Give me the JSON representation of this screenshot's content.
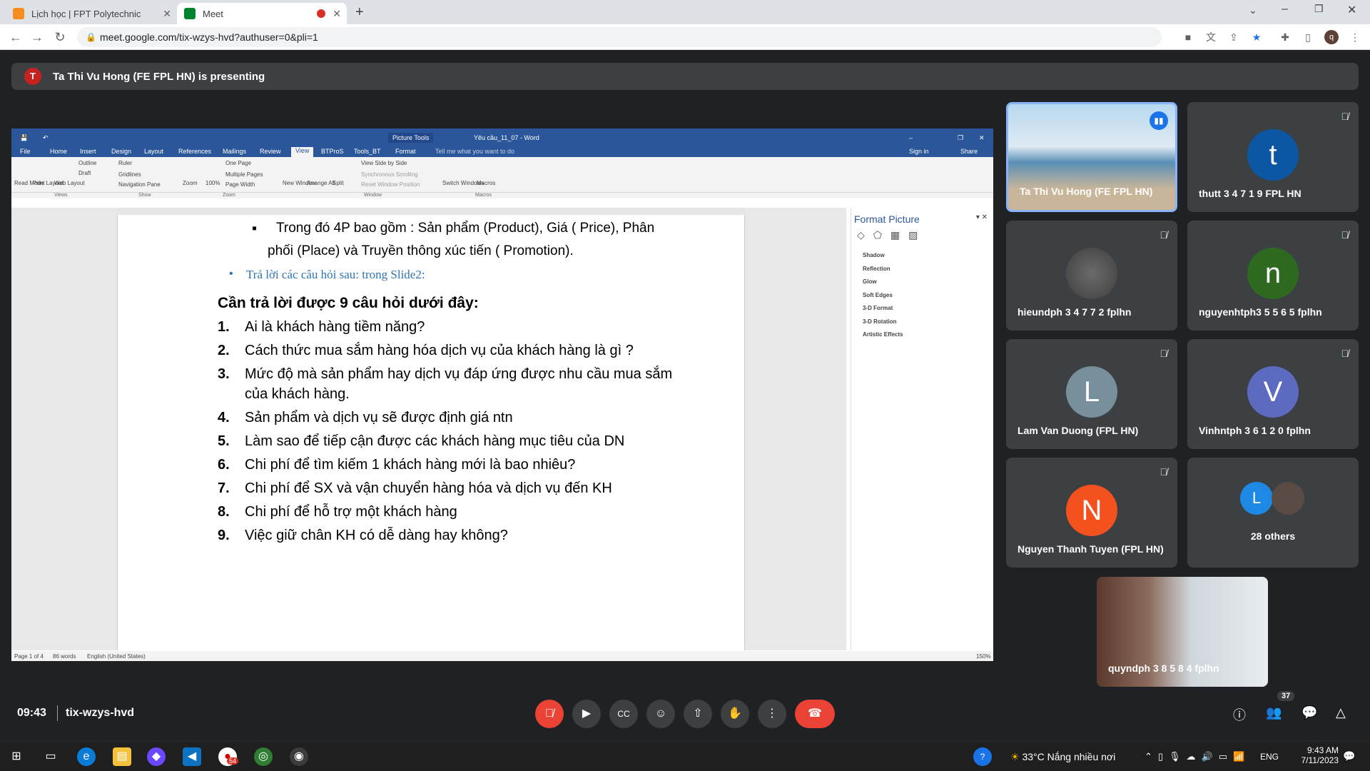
{
  "browser": {
    "tabs": [
      {
        "title": "Lịch học | FPT Polytechnic"
      },
      {
        "title": "Meet"
      }
    ],
    "url": "meet.google.com/tix-wzys-hvd?authuser=0&pli=1",
    "profile_initial": "q"
  },
  "meet": {
    "presenter_initial": "T",
    "presenting_banner": "Ta Thi Vu Hong (FE FPL HN) is presenting",
    "time": "09:43",
    "meeting_code": "tix-wzys-hvd",
    "participant_count": "37",
    "tiles": [
      {
        "name": "Ta Thi Vu Hong (FE FPL HN)"
      },
      {
        "name": "thutt 3 4 7 1 9 FPL HN",
        "initial": "t",
        "color": "#0b57a3"
      },
      {
        "name": "hieundph 3 4 7 7 2 fplhn"
      },
      {
        "name": "nguyenhtph3 5 5 6 5 fplhn",
        "initial": "n",
        "color": "#2d6a1f"
      },
      {
        "name": "Lam Van Duong (FPL HN)",
        "initial": "L",
        "color": "#78909c"
      },
      {
        "name": "Vinhntph 3 6 1 2 0 fplhn",
        "initial": "V",
        "color": "#5c6bc0"
      },
      {
        "name": "Nguyen Thanh Tuyen (FPL HN)",
        "initial": "N",
        "color": "#f4511e"
      },
      {
        "name": "28 others",
        "initial": "L",
        "color": "#1e88e5"
      },
      {
        "name": "quyndph 3 8 5 8 4 fplhn"
      }
    ]
  },
  "word": {
    "title": "Yêu cầu_11_07 - Word",
    "picture_tools": "Picture Tools",
    "tabs": [
      "File",
      "Home",
      "Insert",
      "Design",
      "Layout",
      "References",
      "Mailings",
      "Review",
      "View",
      "BTProS",
      "Tools_BT",
      "Format"
    ],
    "tell_me": "Tell me what you want to do",
    "sign_in": "Sign in",
    "share": "Share",
    "ribbon": {
      "read_mode": "Read Mode",
      "print_layout": "Print Layout",
      "web_layout": "Web Layout",
      "outline": "Outline",
      "draft": "Draft",
      "ruler": "Ruler",
      "gridlines": "Gridlines",
      "nav_pane": "Navigation Pane",
      "zoom": "Zoom",
      "zoom100": "100%",
      "one_page": "One Page",
      "multiple_pages": "Multiple Pages",
      "page_width": "Page Width",
      "new_window": "New Window",
      "arrange_all": "Arrange All",
      "split": "Split",
      "view_side": "View Side by Side",
      "sync_scroll": "Synchronous Scrolling",
      "reset_pos": "Reset Window Position",
      "switch_windows": "Switch Windows",
      "macros": "Macros",
      "grp_views": "Views",
      "grp_show": "Show",
      "grp_zoom": "Zoom",
      "grp_window": "Window",
      "grp_macros": "Macros"
    },
    "bullet1": "Trong đó 4P bao gồm : Sản phẩm (Product), Giá ( Price), Phân",
    "bullet1b": "phối (Place) và Truyền thông xúc tiến ( Promotion).",
    "bullet2": "Trả lời các câu hỏi sau: trong Slide2:",
    "heading": "Cần trả lời được 9 câu hỏi dưới đây:",
    "questions": [
      {
        "n": "1.",
        "t": "Ai là khách hàng tiềm năng?"
      },
      {
        "n": "2.",
        "t": "Cách thức mua sắm hàng hóa dịch vụ của khách hàng là gì ?"
      },
      {
        "n": "3.",
        "t": "Mức độ mà sản phẩm hay dịch vụ đáp ứng được nhu cầu mua sắm"
      },
      {
        "n": "",
        "t": "của khách hàng."
      },
      {
        "n": "4.",
        "t": "Sản phẩm và dịch vụ sẽ được định giá ntn"
      },
      {
        "n": "5.",
        "t": "Làm sao để tiếp cận được các khách hàng mục tiêu của DN"
      },
      {
        "n": "6.",
        "t": "Chi phí để tìm kiếm 1 khách hàng mới là bao nhiêu?"
      },
      {
        "n": "7.",
        "t": "Chi phí để SX và vận chuyển hàng hóa và dịch vụ đến KH"
      },
      {
        "n": "8.",
        "t": "Chi phí để hỗ trợ một khách hàng"
      },
      {
        "n": "9.",
        "t": "Việc giữ chân KH có dễ dàng hay không?"
      }
    ],
    "format_panel": {
      "title": "Format Picture",
      "items": [
        "Shadow",
        "Reflection",
        "Glow",
        "Soft Edges",
        "3-D Format",
        "3-D Rotation",
        "Artistic Effects"
      ]
    },
    "status": {
      "page": "Page 1 of 4",
      "words": "86 words",
      "lang": "English (United States)",
      "zoom": "150%"
    }
  },
  "taskbar": {
    "weather": "33°C  Nắng nhiều nơi",
    "lang": "ENG",
    "time": "9:43 AM",
    "date": "7/11/2023",
    "badge": "54"
  }
}
